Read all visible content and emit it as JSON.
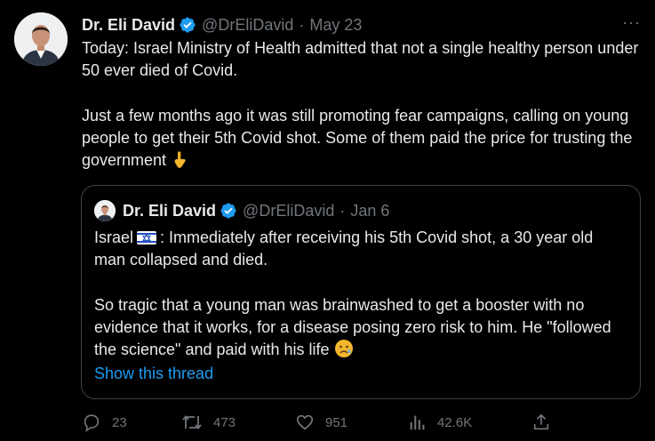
{
  "tweet": {
    "author_name": "Dr. Eli David",
    "handle": "@DrEliDavid",
    "separator": "·",
    "date": "May 23",
    "paragraph1": "Today: Israel Ministry of Health admitted that not a single healthy person under 50 ever died of Covid.",
    "paragraph2": "Just a few months ago it was still promoting fear campaigns, calling on young people to get their 5th Covid shot. Some of them paid the price for trusting the government",
    "emoji_icon": "pointing-down-emoji",
    "more_label": "···"
  },
  "quote": {
    "author_name": "Dr. Eli David",
    "handle": "@DrEliDavid",
    "separator": "·",
    "date": "Jan 6",
    "line1_before_flag": "Israel",
    "line1_after_flag": ": Immediately after receiving his 5th Covid shot, a 30 year old man collapsed and died.",
    "paragraph2": "So tragic that a young man was brainwashed to get a booster with no evidence that it works, for a disease posing zero risk to him. He \"followed the science\" and paid with his life",
    "flag_icon": "israel-flag-icon",
    "emoji_icon": "crying-face-emoji",
    "show_thread": "Show this thread"
  },
  "actions": {
    "replies": "23",
    "retweets": "473",
    "likes": "951",
    "views": "42.6K"
  },
  "colors": {
    "background": "#000000",
    "text": "#e7e9ea",
    "muted": "#71767b",
    "link": "#1d9bf0",
    "border": "#38444d"
  }
}
